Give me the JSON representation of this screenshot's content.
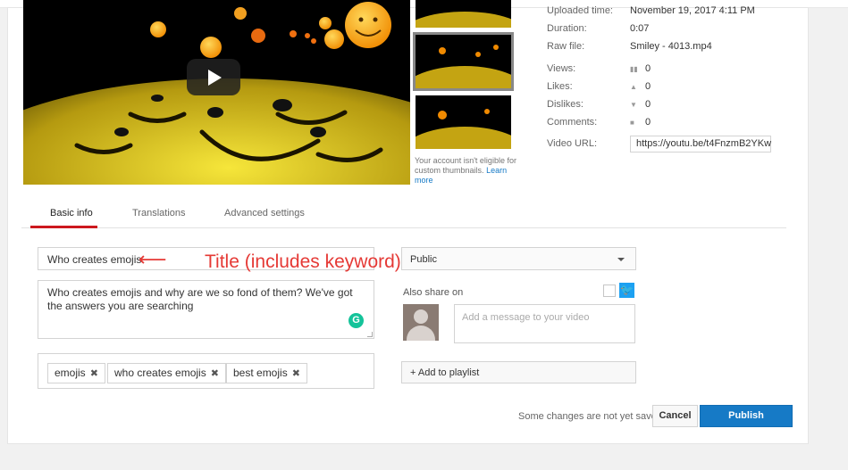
{
  "video": {
    "play_label": "Play video"
  },
  "thumbnails": {
    "note": "Your account isn't eligible for custom thumbnails.",
    "note_link": "Learn more"
  },
  "details": {
    "uploaded_label": "Uploaded time:",
    "uploaded_value": "November 19, 2017 4:11 PM",
    "duration_label": "Duration:",
    "duration_value": "0:07",
    "raw_file_label": "Raw file:",
    "raw_file_value": "Smiley - 4013.mp4",
    "views_label": "Views:",
    "views_value": "0",
    "likes_label": "Likes:",
    "likes_value": "0",
    "dislikes_label": "Dislikes:",
    "dislikes_value": "0",
    "comments_label": "Comments:",
    "comments_value": "0",
    "url_label": "Video URL:",
    "url_value": "https://youtu.be/t4FnzmB2YKw"
  },
  "tabs": [
    {
      "label": "Basic info",
      "active": true
    },
    {
      "label": "Translations",
      "active": false
    },
    {
      "label": "Advanced settings",
      "active": false
    }
  ],
  "form": {
    "title_value": "Who creates emojis",
    "description_value": "Who creates emojis and why are we so fond of them? We've got the answers you are searching",
    "tags": [
      "emojis",
      "who creates emojis",
      "best emojis"
    ],
    "privacy_value": "Public",
    "also_share_label": "Also share on",
    "message_placeholder": "Add a message to your video",
    "playlist_label": "+ Add to playlist"
  },
  "annotation": {
    "arrow": "⟵",
    "text": "Title (includes keyword)"
  },
  "footer": {
    "status": "Some changes are not yet saved.",
    "cancel_label": "Cancel",
    "publish_label": "Publish"
  },
  "colors": {
    "accent_blue": "#167ac6",
    "tab_red": "#cc181e",
    "annotation_red": "#e53935",
    "twitter_blue": "#1da1f2",
    "grammarly_green": "#15c39a"
  }
}
